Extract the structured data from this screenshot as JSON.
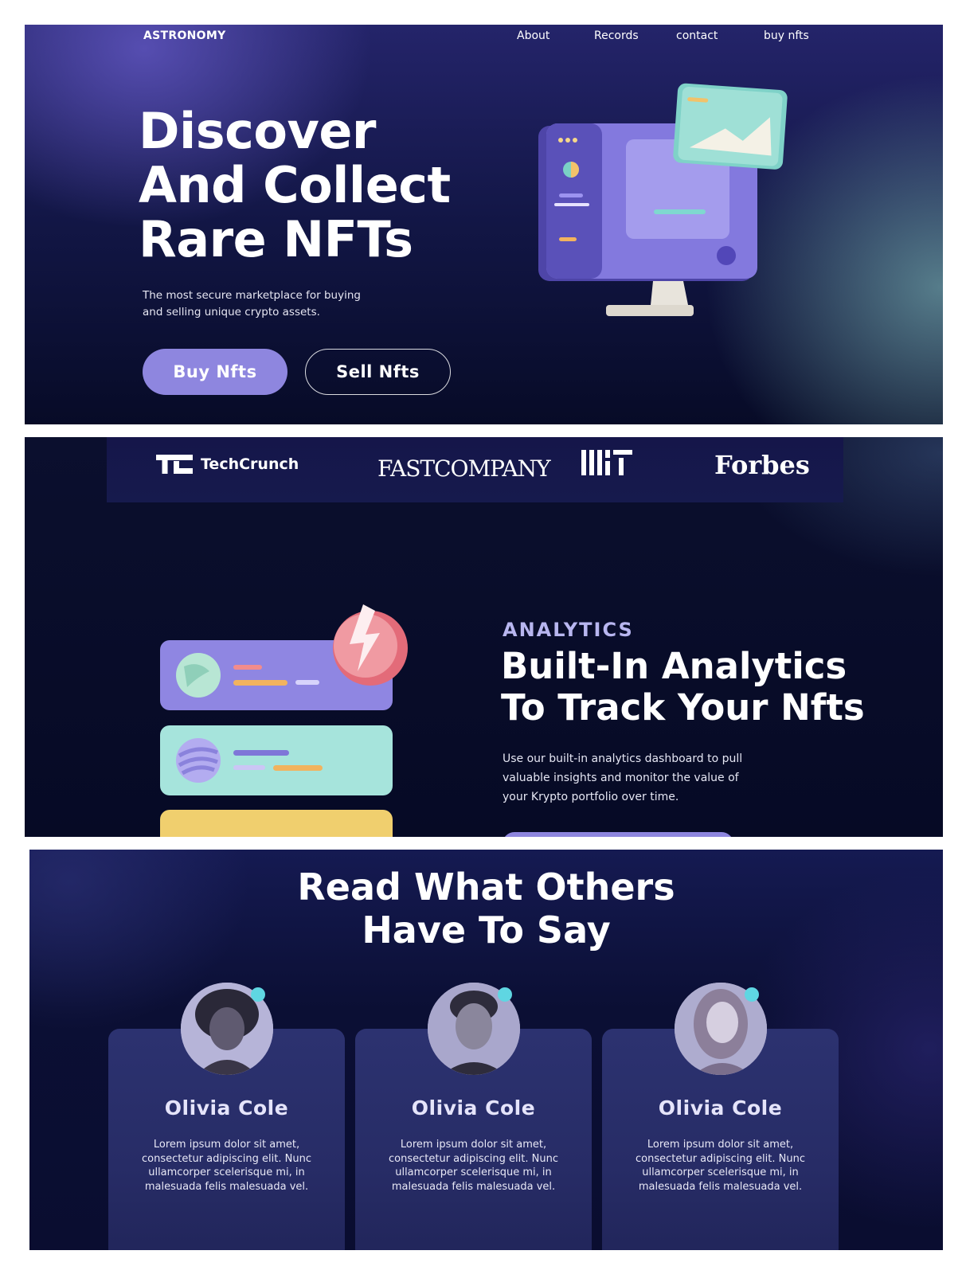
{
  "hero": {
    "brand": "ASTRONOMY",
    "nav": [
      "About",
      "Records",
      "contact",
      "buy nfts"
    ],
    "title_lines": [
      "Discover",
      "And Collect",
      "Rare NFTs"
    ],
    "subtitle": "The most secure marketplace for buying and selling unique crypto assets.",
    "buy_button": "Buy Nfts",
    "sell_button": "Sell Nfts",
    "illustration": "monitor-illustration"
  },
  "press": {
    "logos": [
      "TechCrunch",
      "FASTCOMPANY",
      "MIT",
      "Forbes"
    ],
    "techcrunch_mark": "TC"
  },
  "analytics": {
    "eyebrow": "ANALYTICS",
    "title_lines": [
      "Built-In Analytics",
      "To Track Your Nfts"
    ],
    "body": "Use our built-in analytics dashboard to pull valuable insights and monitor the value of your Krypto portfolio over time.",
    "illustration": "analytics-cards-illustration"
  },
  "testimonials": {
    "title_lines": [
      "Read What Others",
      "Have To Say"
    ],
    "cards": [
      {
        "name": "Olivia Cole",
        "text": "Lorem ipsum dolor sit amet, consectetur adipiscing elit. Nunc ullamcorper scelerisque mi, in malesuada felis malesuada vel."
      },
      {
        "name": "Olivia Cole",
        "text": "Lorem ipsum dolor sit amet, consectetur adipiscing elit. Nunc ullamcorper scelerisque mi, in malesuada felis malesuada vel."
      },
      {
        "name": "Olivia Cole",
        "text": "Lorem ipsum dolor sit amet, consectetur adipiscing elit. Nunc ullamcorper scelerisque mi, in malesuada felis malesuada vel."
      }
    ]
  },
  "colors": {
    "accent_purple": "#8e86df",
    "accent_teal": "#5fd6e2",
    "background_navy": "#070b27"
  }
}
